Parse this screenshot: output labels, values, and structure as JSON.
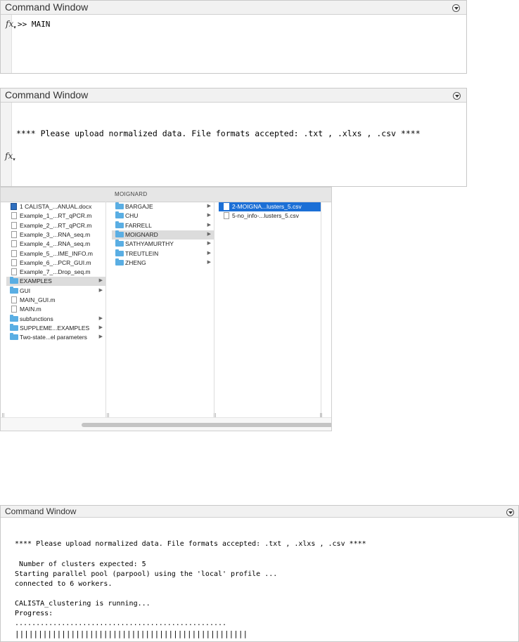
{
  "panel1": {
    "title": "Command Window",
    "prompt_icon": "fx",
    "command": ">> MAIN"
  },
  "panel2": {
    "title": "Command Window",
    "prompt_icon": "fx",
    "message": "**** Please upload normalized data. File formats accepted: .txt , .xlxs , .csv ****"
  },
  "file_browser": {
    "title": "MOIGNARD",
    "column1": [
      {
        "label": "1 CALISTA_...ANUAL.docx",
        "icon": "word-doc-icon",
        "has_children": false
      },
      {
        "label": "Example_1_...RT_qPCR.m",
        "icon": "file-icon",
        "has_children": false
      },
      {
        "label": "Example_2_...RT_qPCR.m",
        "icon": "file-icon",
        "has_children": false
      },
      {
        "label": "Example_3_...RNA_seq.m",
        "icon": "file-icon",
        "has_children": false
      },
      {
        "label": "Example_4_...RNA_seq.m",
        "icon": "file-icon",
        "has_children": false
      },
      {
        "label": "Example_5_...IME_INFO.m",
        "icon": "file-icon",
        "has_children": false
      },
      {
        "label": "Example_6_...PCR_GUI.m",
        "icon": "file-icon",
        "has_children": false
      },
      {
        "label": "Example_7_...Drop_seq.m",
        "icon": "file-icon",
        "has_children": false
      },
      {
        "label": "EXAMPLES",
        "icon": "folder-icon",
        "has_children": true,
        "selected": true
      },
      {
        "label": "GUI",
        "icon": "folder-icon",
        "has_children": true
      },
      {
        "label": "MAIN_GUI.m",
        "icon": "file-icon",
        "has_children": false
      },
      {
        "label": "MAIN.m",
        "icon": "file-icon",
        "has_children": false
      },
      {
        "label": "subfunctions",
        "icon": "folder-icon",
        "has_children": true
      },
      {
        "label": "SUPPLEME...EXAMPLES",
        "icon": "folder-icon",
        "has_children": true
      },
      {
        "label": "Two-state...el parameters",
        "icon": "folder-icon",
        "has_children": true
      }
    ],
    "column2": [
      {
        "label": "BARGAJE",
        "icon": "folder-icon",
        "has_children": true
      },
      {
        "label": "CHU",
        "icon": "folder-icon",
        "has_children": true
      },
      {
        "label": "FARRELL",
        "icon": "folder-icon",
        "has_children": true
      },
      {
        "label": "MOIGNARD",
        "icon": "folder-icon",
        "has_children": true,
        "selected": true
      },
      {
        "label": "SATHYAMURTHY",
        "icon": "folder-icon",
        "has_children": true
      },
      {
        "label": "TREUTLEIN",
        "icon": "folder-icon",
        "has_children": true
      },
      {
        "label": "ZHENG",
        "icon": "folder-icon",
        "has_children": true
      }
    ],
    "column3": [
      {
        "label": "2-MOIGNA...lusters_5.csv",
        "icon": "file-icon",
        "has_children": false,
        "selected": true
      },
      {
        "label": "5-no_info-...lusters_5.csv",
        "icon": "file-icon",
        "has_children": false
      }
    ]
  },
  "panel3": {
    "title": "Command Window",
    "lines": [
      "**** Please upload normalized data. File formats accepted: .txt , .xlxs , .csv ****",
      "",
      " Number of clusters expected: 5",
      "Starting parallel pool (parpool) using the 'local' profile ...",
      "connected to 6 workers.",
      "",
      "CALISTA_clustering is running...",
      "Progress:",
      "..................................................",
      "||||||||||||||||||||||||||||||||||||||||||||||||||"
    ]
  }
}
